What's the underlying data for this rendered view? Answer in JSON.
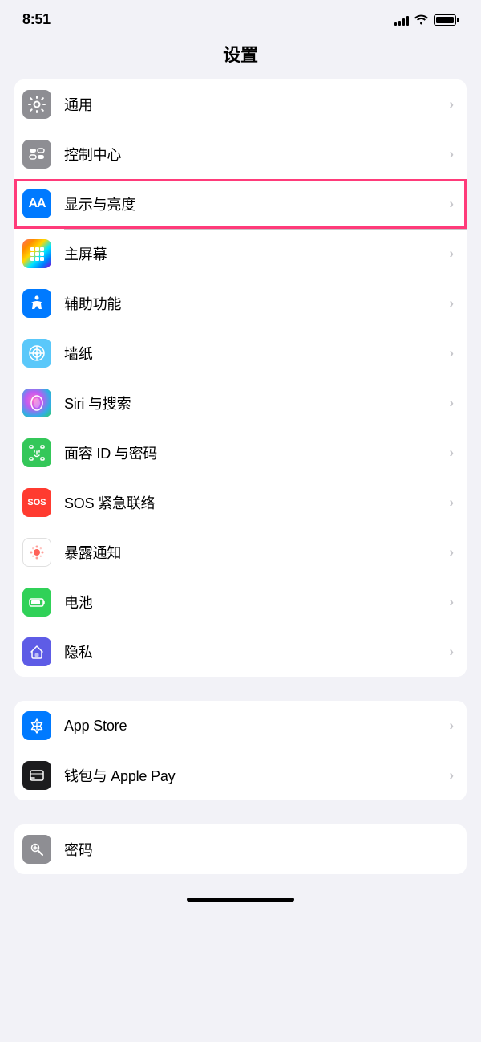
{
  "statusBar": {
    "time": "8:51"
  },
  "pageTitle": "设置",
  "group1": {
    "items": [
      {
        "id": "general",
        "label": "通用",
        "icon": "gear",
        "iconBg": "icon-gray"
      },
      {
        "id": "control-center",
        "label": "控制中心",
        "icon": "toggle",
        "iconBg": "icon-gray"
      },
      {
        "id": "display",
        "label": "显示与亮度",
        "icon": "aa",
        "iconBg": "icon-blue",
        "highlighted": true
      },
      {
        "id": "home-screen",
        "label": "主屏幕",
        "icon": "grid",
        "iconBg": "icon-blue"
      },
      {
        "id": "accessibility",
        "label": "辅助功能",
        "icon": "access",
        "iconBg": "icon-blue"
      },
      {
        "id": "wallpaper",
        "label": "墙纸",
        "icon": "flower",
        "iconBg": "icon-teal"
      },
      {
        "id": "siri",
        "label": "Siri 与搜索",
        "icon": "siri",
        "iconBg": "icon-siri"
      },
      {
        "id": "faceid",
        "label": "面容 ID 与密码",
        "icon": "faceid",
        "iconBg": "icon-green"
      },
      {
        "id": "sos",
        "label": "SOS 紧急联络",
        "icon": "sos",
        "iconBg": "icon-red"
      },
      {
        "id": "exposure",
        "label": "暴露通知",
        "icon": "exposure",
        "iconBg": "icon-red-dots"
      },
      {
        "id": "battery",
        "label": "电池",
        "icon": "battery-icon",
        "iconBg": "icon-dark-green"
      },
      {
        "id": "privacy",
        "label": "隐私",
        "icon": "hand",
        "iconBg": "icon-indigo"
      }
    ]
  },
  "group2": {
    "items": [
      {
        "id": "appstore",
        "label": "App Store",
        "icon": "appstore",
        "iconBg": "icon-blue"
      },
      {
        "id": "wallet",
        "label": "钱包与 Apple Pay",
        "icon": "wallet",
        "iconBg": "icon-black"
      }
    ]
  },
  "group3": {
    "items": [
      {
        "id": "passwords",
        "label": "密码",
        "icon": "key",
        "iconBg": "icon-gray"
      }
    ]
  },
  "chevron": "›"
}
